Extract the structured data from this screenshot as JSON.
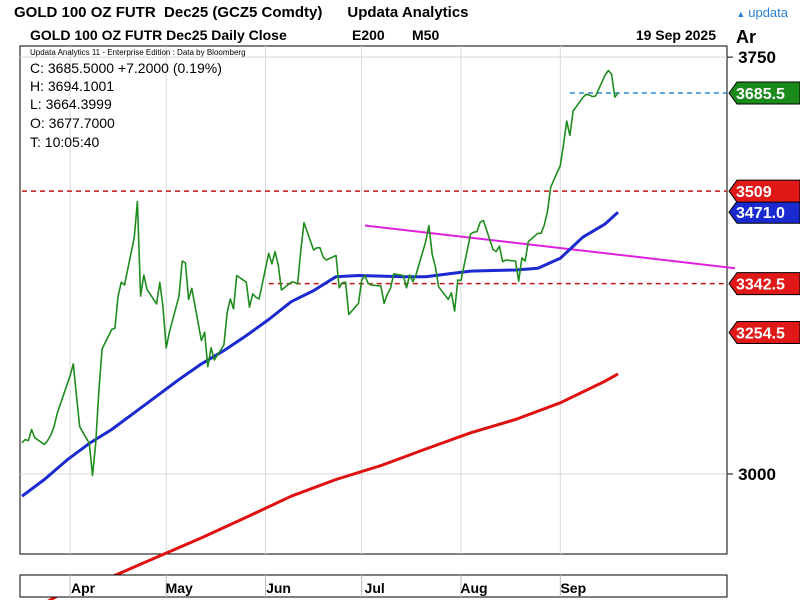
{
  "window": {
    "title": "GOLD 100 OZ FUTR  Dec25 (GCZ5 Comdty)      Updata Analytics",
    "brand": "updata",
    "brand_icon": "triangle-icon"
  },
  "header": {
    "series_label": "GOLD 100 OZ FUTR  Dec25 Daily Close",
    "e200_label": "E200",
    "m50_label": "M50",
    "date": "19 Sep 2025",
    "corner": "Ar",
    "edition": "Updata Analytics 11 - Enterprise Edition : Data by Bloomberg"
  },
  "quote": {
    "close": "C: 3685.5000  +7.2000 (0.19%)",
    "high": "H: 3694.1001",
    "low": "L: 3664.3999",
    "open": "O: 3677.7000",
    "time": "T: 10:05:40"
  },
  "colors": {
    "price": "#1e8c1e",
    "e200": "#e01010",
    "m50": "#1a2ad0",
    "trendline": "#e020e0",
    "level": "#c01818",
    "last_dashed": "#2a8ad4",
    "price_badge": "#1a8a1a",
    "level_badge": "#e01818",
    "ma_badge": "#1a2ad0"
  },
  "chart_data": {
    "type": "line",
    "title": "GOLD 100 OZ FUTR  Dec25 Daily Close",
    "x_start": "2025-03-17",
    "x_end": "2025-09-19",
    "xticks": [
      "Apr",
      "May",
      "Jun",
      "Jul",
      "Aug",
      "Sep"
    ],
    "xtick_dates": [
      "2025-04-01",
      "2025-05-01",
      "2025-06-01",
      "2025-07-01",
      "2025-08-01",
      "2025-09-01"
    ],
    "ylim": [
      2856,
      3770
    ],
    "yticks": [
      3000,
      3750
    ],
    "grid": true,
    "series": [
      {
        "name": "GOLD 100 OZ FUTR  Dec25 Daily Close",
        "points": [
          [
            "2025-03-17",
            3056
          ],
          [
            "2025-03-18",
            3062
          ],
          [
            "2025-03-19",
            3060
          ],
          [
            "2025-03-20",
            3080
          ],
          [
            "2025-03-21",
            3065
          ],
          [
            "2025-03-24",
            3053
          ],
          [
            "2025-03-25",
            3060
          ],
          [
            "2025-03-26",
            3070
          ],
          [
            "2025-03-27",
            3085
          ],
          [
            "2025-03-28",
            3109
          ],
          [
            "2025-03-31",
            3160
          ],
          [
            "2025-04-01",
            3177
          ],
          [
            "2025-04-02",
            3198
          ],
          [
            "2025-04-03",
            3140
          ],
          [
            "2025-04-04",
            3085
          ],
          [
            "2025-04-07",
            3055
          ],
          [
            "2025-04-08",
            2997
          ],
          [
            "2025-04-09",
            3055
          ],
          [
            "2025-04-10",
            3150
          ],
          [
            "2025-04-11",
            3225
          ],
          [
            "2025-04-14",
            3260
          ],
          [
            "2025-04-15",
            3262
          ],
          [
            "2025-04-16",
            3320
          ],
          [
            "2025-04-17",
            3345
          ],
          [
            "2025-04-18",
            3340
          ],
          [
            "2025-04-21",
            3425
          ],
          [
            "2025-04-22",
            3490
          ],
          [
            "2025-04-23",
            3320
          ],
          [
            "2025-04-24",
            3358
          ],
          [
            "2025-04-25",
            3332
          ],
          [
            "2025-04-28",
            3306
          ],
          [
            "2025-04-29",
            3345
          ],
          [
            "2025-04-30",
            3300
          ],
          [
            "2025-05-01",
            3227
          ],
          [
            "2025-05-02",
            3255
          ],
          [
            "2025-05-05",
            3320
          ],
          [
            "2025-05-06",
            3383
          ],
          [
            "2025-05-07",
            3380
          ],
          [
            "2025-05-08",
            3314
          ],
          [
            "2025-05-09",
            3334
          ],
          [
            "2025-05-12",
            3240
          ],
          [
            "2025-05-13",
            3255
          ],
          [
            "2025-05-14",
            3193
          ],
          [
            "2025-05-15",
            3227
          ],
          [
            "2025-05-16",
            3205
          ],
          [
            "2025-05-19",
            3232
          ],
          [
            "2025-05-20",
            3290
          ],
          [
            "2025-05-21",
            3315
          ],
          [
            "2025-05-22",
            3297
          ],
          [
            "2025-05-23",
            3357
          ],
          [
            "2025-05-26",
            3345
          ],
          [
            "2025-05-27",
            3300
          ],
          [
            "2025-05-28",
            3324
          ],
          [
            "2025-05-29",
            3318
          ],
          [
            "2025-05-30",
            3315
          ],
          [
            "2025-06-02",
            3397
          ],
          [
            "2025-06-03",
            3378
          ],
          [
            "2025-06-04",
            3400
          ],
          [
            "2025-06-05",
            3375
          ],
          [
            "2025-06-06",
            3331
          ],
          [
            "2025-06-09",
            3345
          ],
          [
            "2025-06-10",
            3345
          ],
          [
            "2025-06-11",
            3342
          ],
          [
            "2025-06-12",
            3402
          ],
          [
            "2025-06-13",
            3452
          ],
          [
            "2025-06-16",
            3403
          ],
          [
            "2025-06-17",
            3407
          ],
          [
            "2025-06-18",
            3407
          ],
          [
            "2025-06-19",
            3390
          ],
          [
            "2025-06-20",
            3385
          ],
          [
            "2025-06-23",
            3393
          ],
          [
            "2025-06-24",
            3335
          ],
          [
            "2025-06-25",
            3344
          ],
          [
            "2025-06-26",
            3345
          ],
          [
            "2025-06-27",
            3287
          ],
          [
            "2025-06-30",
            3307
          ],
          [
            "2025-07-01",
            3349
          ],
          [
            "2025-07-02",
            3357
          ],
          [
            "2025-07-03",
            3343
          ],
          [
            "2025-07-04",
            3340
          ],
          [
            "2025-07-07",
            3338
          ],
          [
            "2025-07-08",
            3307
          ],
          [
            "2025-07-09",
            3323
          ],
          [
            "2025-07-10",
            3334
          ],
          [
            "2025-07-11",
            3360
          ],
          [
            "2025-07-14",
            3357
          ],
          [
            "2025-07-15",
            3335
          ],
          [
            "2025-07-16",
            3358
          ],
          [
            "2025-07-17",
            3346
          ],
          [
            "2025-07-18",
            3359
          ],
          [
            "2025-07-21",
            3418
          ],
          [
            "2025-07-22",
            3447
          ],
          [
            "2025-07-23",
            3395
          ],
          [
            "2025-07-24",
            3373
          ],
          [
            "2025-07-25",
            3337
          ],
          [
            "2025-07-28",
            3314
          ],
          [
            "2025-07-29",
            3326
          ],
          [
            "2025-07-30",
            3293
          ],
          [
            "2025-07-31",
            3349
          ],
          [
            "2025-08-01",
            3348
          ],
          [
            "2025-08-04",
            3432
          ],
          [
            "2025-08-05",
            3435
          ],
          [
            "2025-08-06",
            3436
          ],
          [
            "2025-08-07",
            3453
          ],
          [
            "2025-08-08",
            3456
          ],
          [
            "2025-08-11",
            3404
          ],
          [
            "2025-08-12",
            3400
          ],
          [
            "2025-08-13",
            3410
          ],
          [
            "2025-08-14",
            3382
          ],
          [
            "2025-08-15",
            3385
          ],
          [
            "2025-08-18",
            3383
          ],
          [
            "2025-08-19",
            3347
          ],
          [
            "2025-08-20",
            3389
          ],
          [
            "2025-08-21",
            3383
          ],
          [
            "2025-08-22",
            3418
          ],
          [
            "2025-08-25",
            3433
          ],
          [
            "2025-08-26",
            3433
          ],
          [
            "2025-08-27",
            3448
          ],
          [
            "2025-08-28",
            3473
          ],
          [
            "2025-08-29",
            3516
          ],
          [
            "2025-09-01",
            3555
          ],
          [
            "2025-09-02",
            3592
          ],
          [
            "2025-09-03",
            3635
          ],
          [
            "2025-09-04",
            3609
          ],
          [
            "2025-09-05",
            3653
          ],
          [
            "2025-09-08",
            3677
          ],
          [
            "2025-09-09",
            3683
          ],
          [
            "2025-09-10",
            3682
          ],
          [
            "2025-09-11",
            3679
          ],
          [
            "2025-09-12",
            3680
          ],
          [
            "2025-09-15",
            3718
          ],
          [
            "2025-09-16",
            3726
          ],
          [
            "2025-09-17",
            3719
          ],
          [
            "2025-09-18",
            3678
          ],
          [
            "2025-09-19",
            3685.5
          ]
        ]
      },
      {
        "name": "M50",
        "points": [
          [
            "2025-03-17",
            2960
          ],
          [
            "2025-03-24",
            2990
          ],
          [
            "2025-03-31",
            3025
          ],
          [
            "2025-04-07",
            3055
          ],
          [
            "2025-04-14",
            3080
          ],
          [
            "2025-04-21",
            3110
          ],
          [
            "2025-04-28",
            3140
          ],
          [
            "2025-05-05",
            3170
          ],
          [
            "2025-05-12",
            3198
          ],
          [
            "2025-05-19",
            3222
          ],
          [
            "2025-05-26",
            3249
          ],
          [
            "2025-06-02",
            3278
          ],
          [
            "2025-06-09",
            3310
          ],
          [
            "2025-06-16",
            3330
          ],
          [
            "2025-06-23",
            3355
          ],
          [
            "2025-06-30",
            3357
          ],
          [
            "2025-07-07",
            3356
          ],
          [
            "2025-07-14",
            3355
          ],
          [
            "2025-07-21",
            3355
          ],
          [
            "2025-07-28",
            3360
          ],
          [
            "2025-08-04",
            3365
          ],
          [
            "2025-08-11",
            3366
          ],
          [
            "2025-08-18",
            3367
          ],
          [
            "2025-08-25",
            3370
          ],
          [
            "2025-09-01",
            3388
          ],
          [
            "2025-09-08",
            3426
          ],
          [
            "2025-09-15",
            3450
          ],
          [
            "2025-09-19",
            3471
          ]
        ]
      },
      {
        "name": "E200",
        "points": [
          [
            "2025-03-17",
            2745
          ],
          [
            "2025-03-31",
            2790
          ],
          [
            "2025-04-14",
            2815
          ],
          [
            "2025-04-28",
            2850
          ],
          [
            "2025-05-12",
            2885
          ],
          [
            "2025-05-26",
            2922
          ],
          [
            "2025-06-09",
            2960
          ],
          [
            "2025-06-23",
            2990
          ],
          [
            "2025-07-07",
            3015
          ],
          [
            "2025-07-21",
            3045
          ],
          [
            "2025-08-04",
            3074
          ],
          [
            "2025-08-18",
            3098
          ],
          [
            "2025-09-01",
            3128
          ],
          [
            "2025-09-15",
            3167
          ],
          [
            "2025-09-19",
            3180
          ]
        ]
      }
    ],
    "levels": [
      {
        "from": "2025-03-17",
        "to": "2025-09-19",
        "value": 3509,
        "label": "3509"
      },
      {
        "from": "2025-06-02",
        "to": "2025-09-19",
        "value": 3342.5,
        "label": "3342.5"
      },
      {
        "from": "2025-09-04",
        "to": "2025-09-19",
        "value": 3685.5,
        "label": "3685.5",
        "style": "last"
      }
    ],
    "trendline": {
      "from": [
        "2025-07-02",
        3447
      ],
      "to": [
        "2025-09-19",
        3372
      ]
    },
    "badges": [
      {
        "value": 3685.5,
        "label": "3685.5",
        "color": "price_badge"
      },
      {
        "value": 3509,
        "label": "3509",
        "color": "level_badge"
      },
      {
        "value": 3342.5,
        "label": "3342.5",
        "color": "level_badge"
      },
      {
        "value": 3254.5,
        "label": "3254.5",
        "color": "level_badge"
      },
      {
        "value": 3471,
        "label": "3471.0",
        "color": "ma_badge"
      }
    ]
  }
}
